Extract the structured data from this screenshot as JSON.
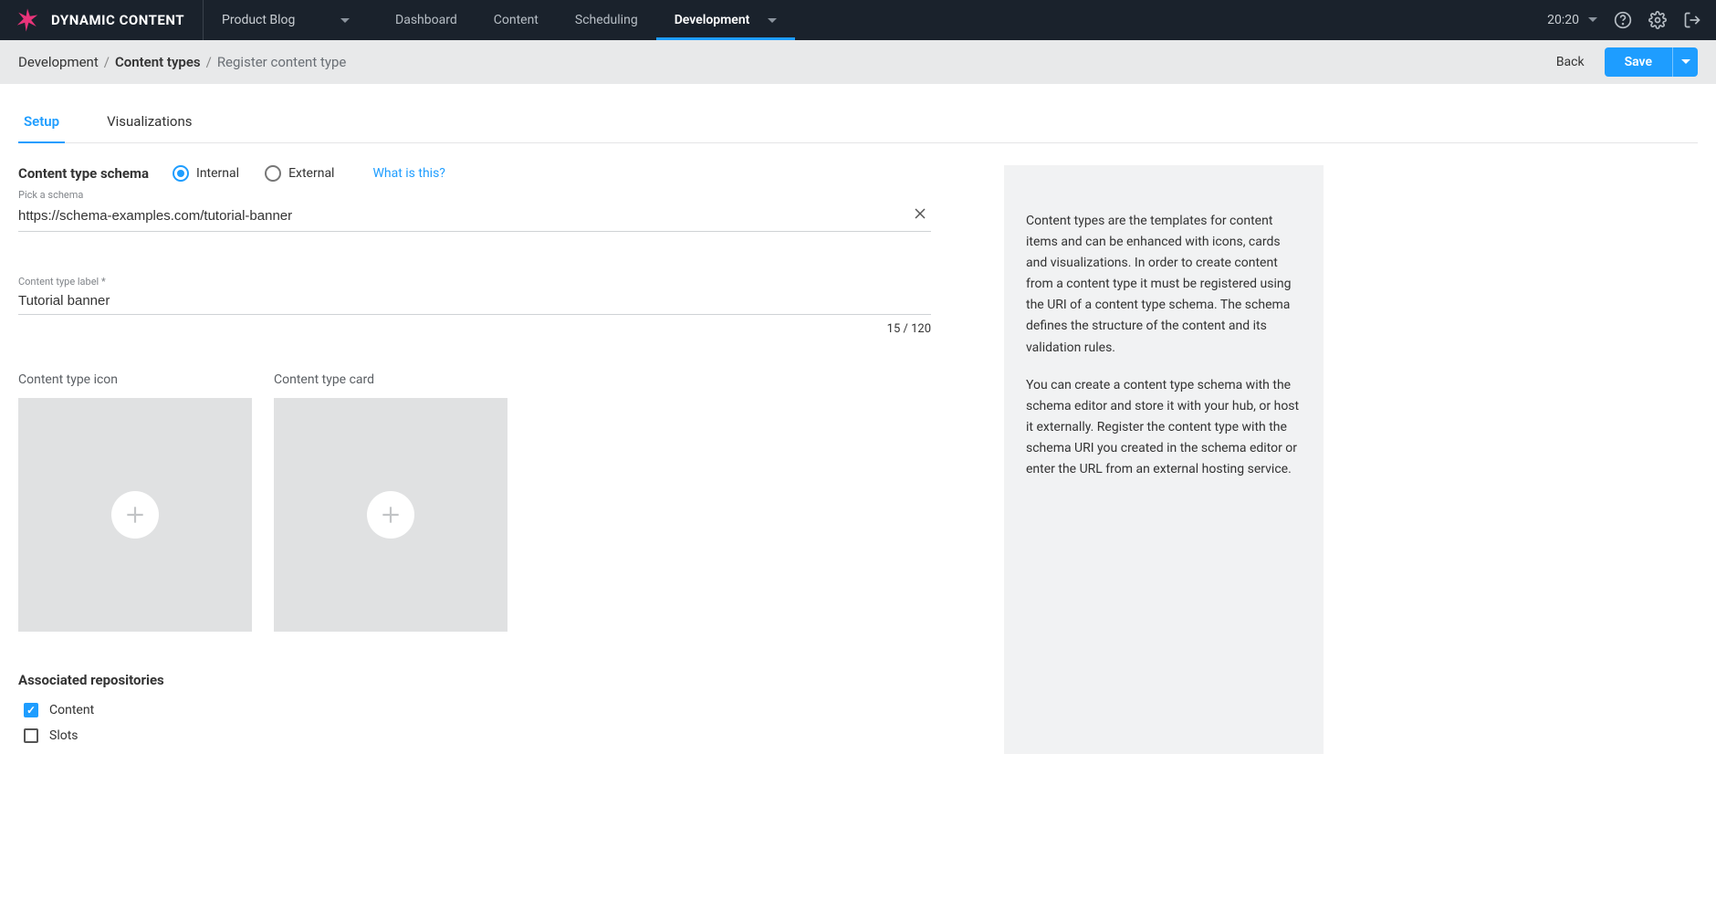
{
  "brand": {
    "name": "DYNAMIC CONTENT"
  },
  "hub": {
    "name": "Product Blog"
  },
  "nav": {
    "tabs": [
      {
        "label": "Dashboard",
        "active": false,
        "hasCaret": false
      },
      {
        "label": "Content",
        "active": false,
        "hasCaret": false
      },
      {
        "label": "Scheduling",
        "active": false,
        "hasCaret": false
      },
      {
        "label": "Development",
        "active": true,
        "hasCaret": true
      }
    ],
    "time": "20:20"
  },
  "breadcrumb": {
    "items": [
      {
        "label": "Development",
        "bold": false,
        "link": true
      },
      {
        "label": "Content types",
        "bold": true,
        "link": true
      },
      {
        "label": "Register content type",
        "bold": false,
        "link": false
      }
    ]
  },
  "actions": {
    "back": "Back",
    "save": "Save"
  },
  "pageTabs": [
    {
      "label": "Setup",
      "active": true
    },
    {
      "label": "Visualizations",
      "active": false
    }
  ],
  "form": {
    "schemaSectionLabel": "Content type schema",
    "schemaSourceOptions": [
      {
        "label": "Internal",
        "selected": true
      },
      {
        "label": "External",
        "selected": false
      }
    ],
    "whatIsThis": "What is this?",
    "pickHint": "Pick a schema",
    "schemaValue": "https://schema-examples.com/tutorial-banner",
    "labelFieldLabel": "Content type label *",
    "labelValue": "Tutorial banner",
    "labelCounter": "15 / 120",
    "iconTitle": "Content type icon",
    "cardTitle": "Content type card",
    "reposTitle": "Associated repositories",
    "repos": [
      {
        "label": "Content",
        "checked": true
      },
      {
        "label": "Slots",
        "checked": false
      }
    ]
  },
  "help": {
    "p1": "Content types are the templates for content items and can be enhanced with icons, cards and visualizations. In order to create content from a content type it must be registered using the URI of a content type schema. The schema defines the structure of the content and its validation rules.",
    "p2": "You can create a content type schema with the schema editor and store it with your hub, or host it externally. Register the content type with the schema URI you created in the schema editor or enter the URL from an external hosting service."
  }
}
